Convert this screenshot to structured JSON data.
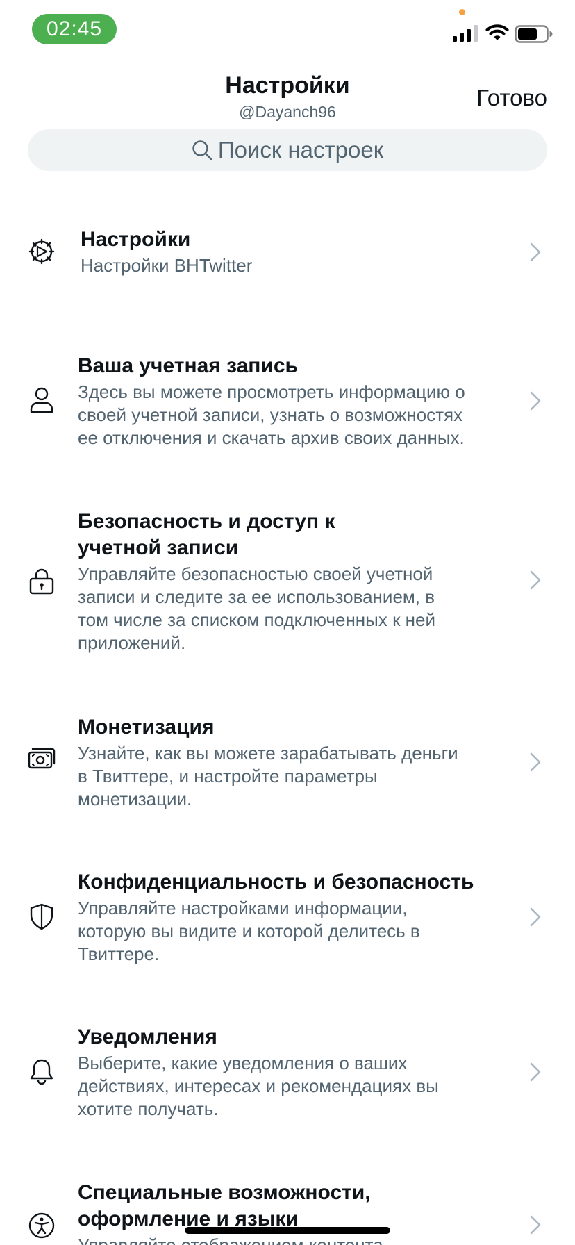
{
  "status_bar": {
    "time": "02:45",
    "icons": [
      "signal-icon",
      "wifi-icon",
      "battery-icon"
    ],
    "colors": {
      "time_pill": "#4caf50",
      "recording_dot": "#f5a142"
    }
  },
  "header": {
    "title": "Настройки",
    "handle": "@Dayanch96",
    "done_label": "Готово"
  },
  "search": {
    "placeholder": "Поиск настроек"
  },
  "settings": [
    {
      "icon": "gear-icon",
      "title": "Настройки",
      "lines": [
        "Настройки BHTwitter"
      ]
    },
    {
      "icon": "person-icon",
      "title": "Ваша учетная запись",
      "lines": [
        "Здесь вы можете просмотреть информацию о",
        "своей учетной записи, узнать о возможностях",
        "ее отключения и скачать архив своих данных."
      ]
    },
    {
      "icon": "lock-icon",
      "title": "Безопасность и доступ к учетной записи",
      "title_lines": [
        "Безопасность и доступ к",
        "учетной записи"
      ],
      "lines": [
        "Управляйте безопасностью своей учетной",
        "записи и следите за ее использованием, в",
        "том числе за списком подключенных к ней",
        "приложений."
      ]
    },
    {
      "icon": "money-icon",
      "title": "Монетизация",
      "lines": [
        "Узнайте, как вы можете зарабатывать деньги",
        "в Твиттере, и настройте параметры",
        "монетизации."
      ]
    },
    {
      "icon": "shield-icon",
      "title": "Конфиденциальность и безопасность",
      "lines": [
        "Управляйте настройками информации,",
        "которую вы видите и которой делитесь в",
        "Твиттере."
      ]
    },
    {
      "icon": "bell-icon",
      "title": "Уведомления",
      "lines": [
        "Выберите, какие уведомления о ваших",
        "действиях, интересах и рекомендациях вы",
        "хотите получать."
      ]
    },
    {
      "icon": "accessibility-icon",
      "title": "Специальные возможности, оформление и языки",
      "title_lines": [
        "Специальные возможности,",
        "оформление и языки"
      ],
      "lines": [
        "Управляйте отображением контента"
      ]
    }
  ],
  "colors": {
    "primary_text": "#0f1419",
    "secondary_text": "#536471",
    "search_bg": "#eff3f4",
    "chevron": "#aab8c2"
  }
}
